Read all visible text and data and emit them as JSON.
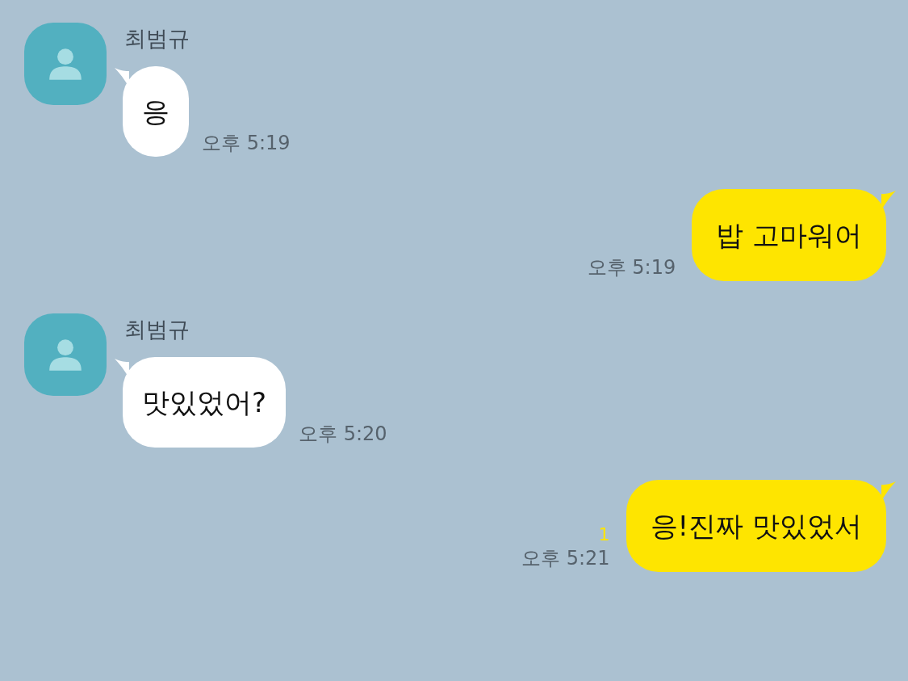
{
  "messages": [
    {
      "kind": "incoming",
      "sender": "최범규",
      "text": "응",
      "time": "오후 5:19"
    },
    {
      "kind": "outgoing",
      "text": "밥 고마워어",
      "time": "오후 5:19"
    },
    {
      "kind": "incoming",
      "sender": "최범규",
      "text": "맛있었어?",
      "time": "오후 5:20"
    },
    {
      "kind": "outgoing",
      "text": "응!진짜 맛있었서",
      "time": "오후 5:21",
      "unread": "1"
    }
  ]
}
